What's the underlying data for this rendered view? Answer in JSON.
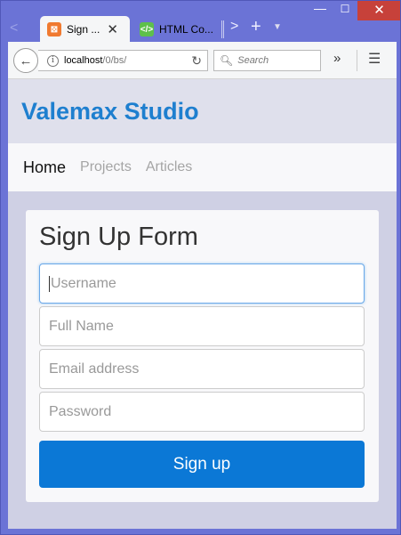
{
  "browser": {
    "tabs": [
      {
        "label": "Sign ...",
        "favicon": "xampp-icon"
      },
      {
        "label": "HTML Co...",
        "favicon": "html-code-icon"
      }
    ],
    "url": {
      "host": "localhost",
      "path": "/0/bs/"
    },
    "search_placeholder": "Search",
    "window_controls": {
      "min": "—",
      "max": "☐",
      "close": "✕"
    }
  },
  "site": {
    "brand": "Valemax Studio",
    "nav": [
      "Home",
      "Projects",
      "Articles"
    ]
  },
  "form": {
    "title": "Sign Up Form",
    "fields": [
      {
        "placeholder": "Username"
      },
      {
        "placeholder": "Full Name"
      },
      {
        "placeholder": "Email address"
      },
      {
        "placeholder": "Password"
      }
    ],
    "submit_label": "Sign up"
  },
  "colors": {
    "brand": "#1e7fcf",
    "button": "#0b78d6",
    "window_frame": "#6b73d6",
    "window_close": "#c7413a"
  }
}
